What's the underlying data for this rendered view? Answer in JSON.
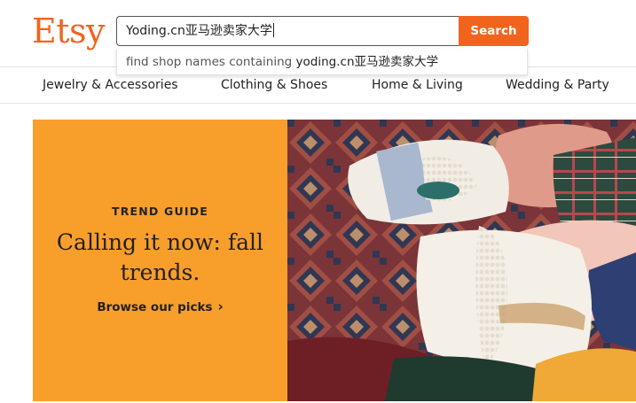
{
  "brand": {
    "logo_text": "Etsy",
    "accent": "#f1641e"
  },
  "search": {
    "value": "Yoding.cn亚马逊卖家大学",
    "button_label": "Search"
  },
  "suggestion": {
    "prefix": "find shop names containing ",
    "query": "yoding.cn亚马逊卖家大学"
  },
  "nav": {
    "items": [
      {
        "label": "Jewelry & Accessories"
      },
      {
        "label": "Clothing & Shoes"
      },
      {
        "label": "Home & Living"
      },
      {
        "label": "Wedding & Party"
      }
    ]
  },
  "hero": {
    "eyebrow": "TREND GUIDE",
    "headline": "Calling it now: fall trends.",
    "cta_label": "Browse our picks",
    "panel_color": "#f89e2b"
  }
}
